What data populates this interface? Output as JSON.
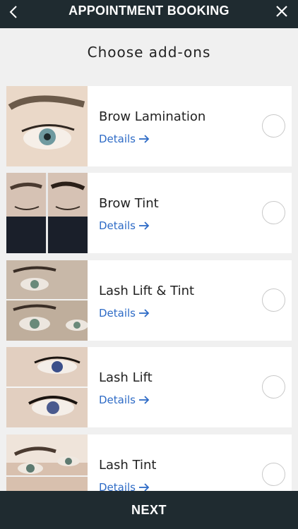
{
  "header": {
    "title": "APPOINTMENT BOOKING",
    "back_icon": "chevron-left-icon",
    "close_icon": "close-icon"
  },
  "page_heading": "Choose add-ons",
  "addons": [
    {
      "name": "Brow Lamination",
      "details_label": "Details",
      "selected": false
    },
    {
      "name": "Brow Tint",
      "details_label": "Details",
      "selected": false
    },
    {
      "name": "Lash Lift & Tint",
      "details_label": "Details",
      "selected": false
    },
    {
      "name": "Lash Lift",
      "details_label": "Details",
      "selected": false
    },
    {
      "name": "Lash Tint",
      "details_label": "Details",
      "selected": false
    }
  ],
  "footer": {
    "next_label": "NEXT"
  },
  "colors": {
    "bar": "#1f2b30",
    "link": "#2e6bc6",
    "background": "#f0f0f0"
  }
}
